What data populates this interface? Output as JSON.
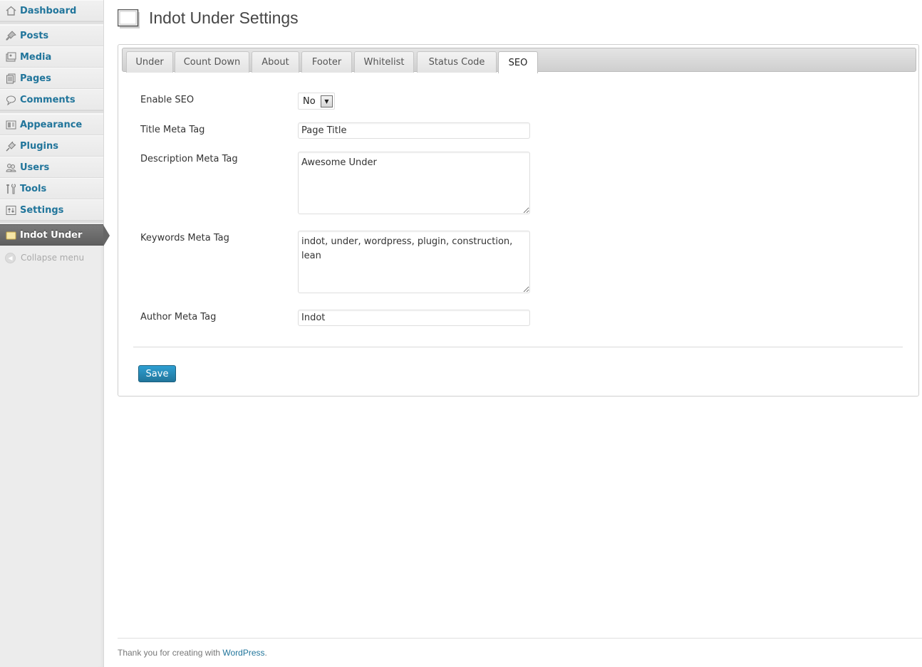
{
  "sidebar": {
    "items": [
      {
        "label": "Dashboard",
        "icon": "dashboard-icon"
      },
      {
        "label": "Posts",
        "icon": "pin-icon"
      },
      {
        "label": "Media",
        "icon": "media-icon"
      },
      {
        "label": "Pages",
        "icon": "pages-icon"
      },
      {
        "label": "Comments",
        "icon": "comment-icon"
      },
      {
        "label": "Appearance",
        "icon": "appearance-icon"
      },
      {
        "label": "Plugins",
        "icon": "plug-icon"
      },
      {
        "label": "Users",
        "icon": "users-icon"
      },
      {
        "label": "Tools",
        "icon": "tools-icon"
      },
      {
        "label": "Settings",
        "icon": "settings-icon"
      },
      {
        "label": "Indot Under",
        "icon": "indot-under-icon"
      }
    ],
    "collapse_label": "Collapse menu"
  },
  "header": {
    "title": "Indot Under Settings"
  },
  "tabs": [
    {
      "label": "Under"
    },
    {
      "label": "Count Down"
    },
    {
      "label": "About"
    },
    {
      "label": "Footer"
    },
    {
      "label": "Whitelist"
    },
    {
      "label": "Status Code"
    },
    {
      "label": "SEO"
    }
  ],
  "form": {
    "enable_seo": {
      "label": "Enable SEO",
      "value": "No"
    },
    "title_meta": {
      "label": "Title Meta Tag",
      "value": "Page Title"
    },
    "description_meta": {
      "label": "Description Meta Tag",
      "value": "Awesome Under"
    },
    "keywords_meta": {
      "label": "Keywords Meta Tag",
      "value": "indot, under, wordpress, plugin, construction, lean"
    },
    "author_meta": {
      "label": "Author Meta Tag",
      "value": "Indot"
    },
    "save_label": "Save"
  },
  "footer": {
    "text": "Thank you for creating with ",
    "link": "WordPress",
    "suffix": "."
  },
  "colors": {
    "accent": "#21759b",
    "current_menu": "#666666",
    "button": "#2e9fd2"
  }
}
